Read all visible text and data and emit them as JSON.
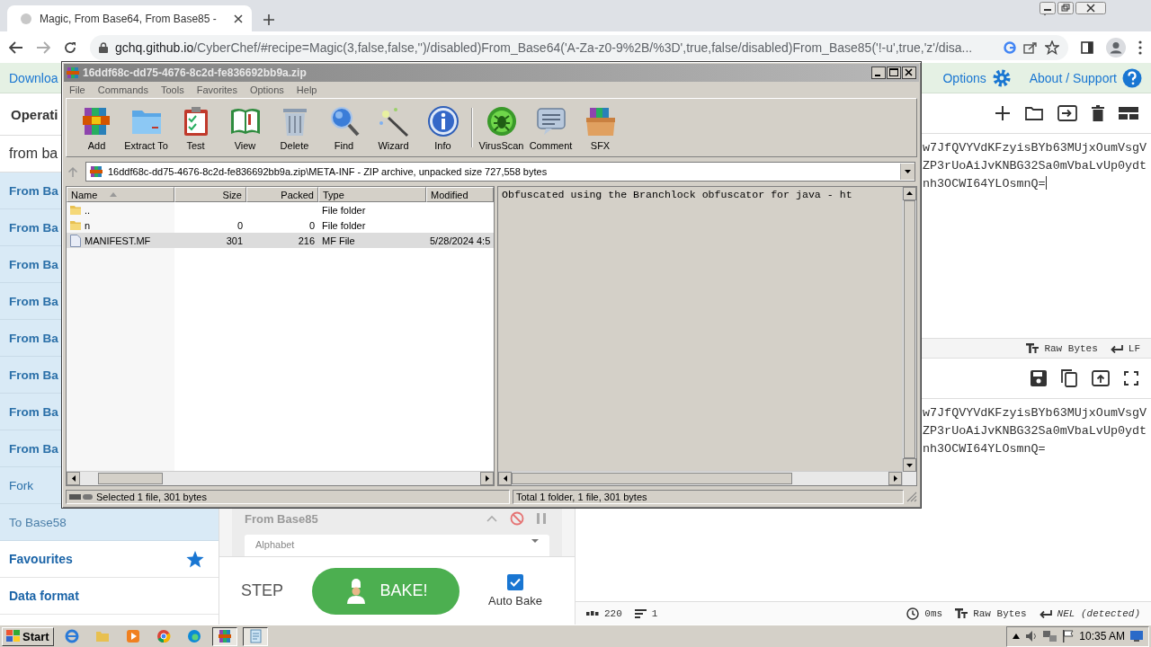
{
  "browser": {
    "tab_title": "Magic, From Base64, From Base85 -",
    "url_host": "gchq.github.io",
    "url_path": "/CyberChef/#recipe=Magic(3,false,false,'')/disabled)From_Base64('A-Za-z0-9%2B/%3D',true,false/disabled)From_Base85('!-u',true,'z'/disa..."
  },
  "chef": {
    "banner_text": "Downloa",
    "header_links": [
      {
        "label": "Options",
        "kind": "gear"
      },
      {
        "label": "About / Support",
        "kind": "help"
      }
    ],
    "operations_title": "Operati",
    "search_value": "from ba",
    "operations": [
      {
        "label": "From Ba",
        "kind": "bold"
      },
      {
        "label": "From Ba",
        "kind": "bold"
      },
      {
        "label": "From Ba",
        "kind": "bold"
      },
      {
        "label": "From Ba",
        "kind": "bold"
      },
      {
        "label": "From Ba",
        "kind": "bold"
      },
      {
        "label": "From Ba",
        "kind": "bold"
      },
      {
        "label": "From Ba",
        "kind": "bold"
      },
      {
        "label": "From Ba",
        "kind": "bold"
      },
      {
        "label": "Fork",
        "kind": "plain"
      },
      {
        "label": "To Base58",
        "kind": "light"
      }
    ],
    "categories": [
      {
        "label": "Favourites",
        "kind": "star"
      },
      {
        "label": "Data format",
        "kind": "plain"
      }
    ],
    "recipe_op": "From Base85",
    "recipe_field_label": "Alphabet",
    "step": "STEP",
    "bake": "BAKE!",
    "auto_bake": {
      "label": "Auto Bake",
      "checked": true
    },
    "input_lines": [
      "w7JfQVYVdKFzyisBYb63MUjxOumVsgV",
      "ZP3rUoAiJvKNBG32Sa0mVbaLvUp0ydt",
      "nh3OCWI64YLOsmnQ="
    ],
    "input_status": [
      {
        "label": "Raw Bytes",
        "kind": "charset"
      },
      {
        "label": "LF",
        "kind": "eol"
      }
    ],
    "output_lines": [
      "w7JfQVYVdKFzyisBYb63MUjxOumVsgV",
      "ZP3rUoAiJvKNBG32Sa0mVbaLvUp0ydt",
      "nh3OCWI64YLOsmnQ="
    ],
    "output_stats": [
      {
        "label": "220",
        "kind": "length"
      },
      {
        "label": "1",
        "kind": "lines"
      }
    ],
    "output_status": [
      {
        "label": "0ms",
        "kind": "time"
      },
      {
        "label": "Raw Bytes",
        "kind": "charset"
      },
      {
        "label": "NEL (detected)",
        "kind": "eol"
      }
    ]
  },
  "rar": {
    "title": "16ddf68c-dd75-4676-8c2d-fe836692bb9a.zip",
    "menu": [
      "File",
      "Commands",
      "Tools",
      "Favorites",
      "Options",
      "Help"
    ],
    "toolbar": [
      {
        "label": "Add",
        "kind": "books"
      },
      {
        "label": "Extract To",
        "kind": "folder"
      },
      {
        "label": "Test",
        "kind": "clipboard"
      },
      {
        "label": "View",
        "kind": "book"
      },
      {
        "label": "Delete",
        "kind": "trash"
      },
      {
        "label": "Find",
        "kind": "search"
      },
      {
        "label": "Wizard",
        "kind": "wand"
      },
      {
        "label": "Info",
        "kind": "info"
      },
      {
        "label": "VirusScan",
        "kind": "bug"
      },
      {
        "label": "Comment",
        "kind": "speech"
      },
      {
        "label": "SFX",
        "kind": "box"
      }
    ],
    "path": "16ddf68c-dd75-4676-8c2d-fe836692bb9a.zip\\META-INF - ZIP archive, unpacked size 727,558 bytes",
    "columns": [
      "Name",
      "Size",
      "Packed",
      "Type",
      "Modified"
    ],
    "rows": [
      {
        "kind": "folder",
        "cells": [
          "..",
          "",
          "",
          "File folder",
          ""
        ],
        "selected": false
      },
      {
        "kind": "folder",
        "cells": [
          "n",
          "0",
          "0",
          "File folder",
          ""
        ],
        "selected": false
      },
      {
        "kind": "file",
        "cells": [
          "MANIFEST.MF",
          "301",
          "216",
          "MF File",
          "5/28/2024 4:5"
        ],
        "selected": true
      }
    ],
    "preview": "Obfuscated using the Branchlock obfuscator for java - ht",
    "status": [
      "Selected 1 file, 301 bytes",
      "Total 1 folder, 1 file, 301 bytes"
    ]
  },
  "taskbar": {
    "start": "Start",
    "clock": "10:35 AM"
  }
}
